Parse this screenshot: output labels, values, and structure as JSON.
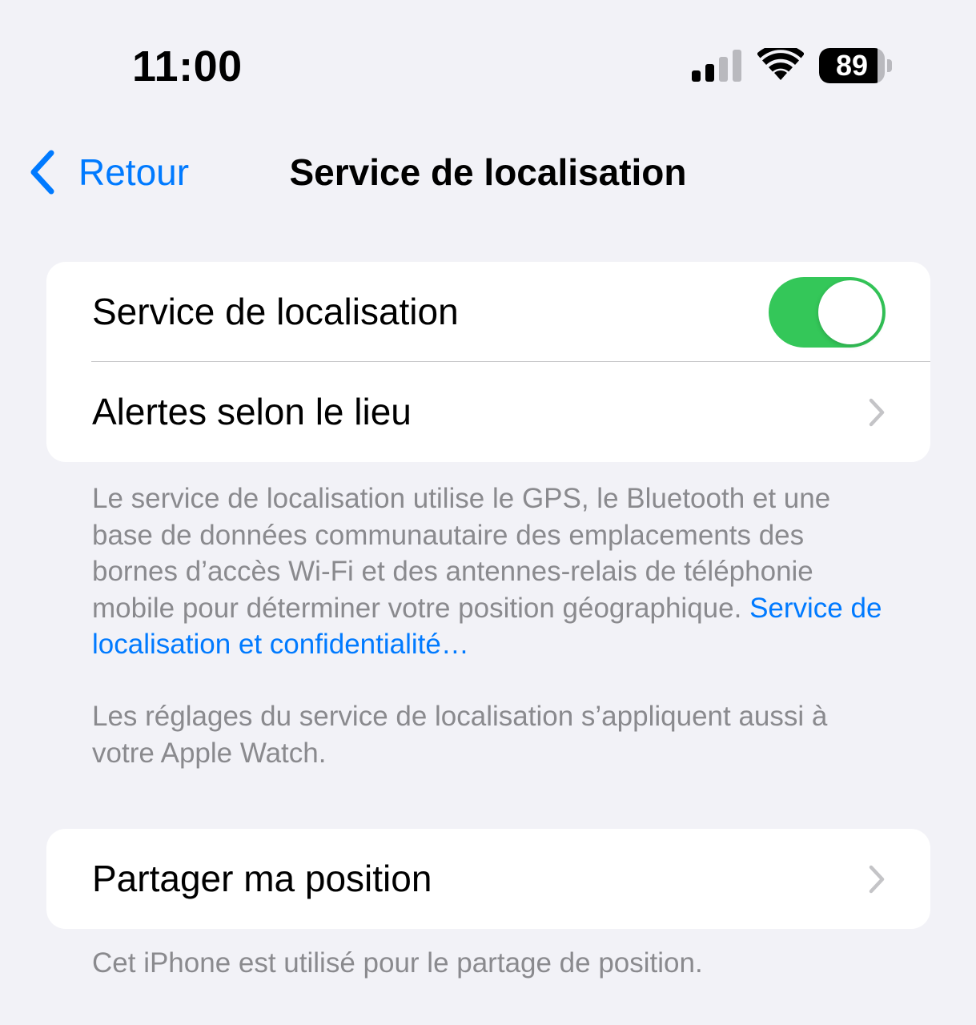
{
  "status_bar": {
    "time": "11:00",
    "battery_level": "89",
    "battery_fraction": 0.89,
    "signal_bars_active": 2,
    "signal_bars_total": 4
  },
  "nav": {
    "back_label": "Retour",
    "title": "Service de localisation"
  },
  "group1": {
    "location_service": {
      "label": "Service de localisation",
      "toggle_on": true
    },
    "location_alerts": {
      "label": "Alertes selon le lieu"
    }
  },
  "footer1": {
    "text": "Le service de localisation utilise le GPS, le Bluetooth et une base de données communautaire des emplacements des bornes d’accès Wi-Fi et des antennes-relais de téléphonie mobile pour déterminer votre position géographique. ",
    "link": "Service de localisation et confidentialité…"
  },
  "footer2": {
    "text": "Les réglages du service de localisation s’appliquent aussi à votre Apple Watch."
  },
  "group2": {
    "share_location": {
      "label": "Partager ma position"
    }
  },
  "footer3": {
    "text": "Cet iPhone est utilisé pour le partage de position."
  },
  "colors": {
    "accent": "#007aff",
    "toggle_on": "#34c759",
    "background": "#f2f2f7",
    "secondary_text": "#8a8a8e"
  },
  "icons": {
    "back": "chevron-left-icon",
    "disclosure": "chevron-right-icon",
    "signal": "cellular-signal-icon",
    "wifi": "wifi-icon",
    "battery": "battery-icon"
  }
}
